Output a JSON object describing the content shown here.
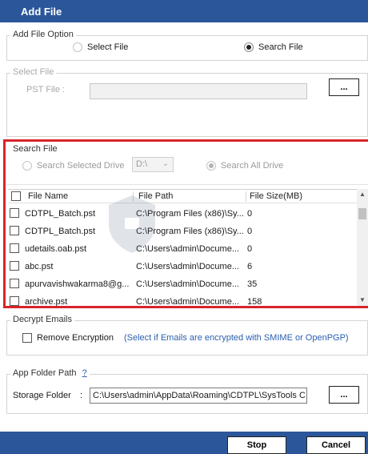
{
  "window": {
    "title": "Add File"
  },
  "add_file_option": {
    "label": "Add File Option",
    "select_file_label": "Select File",
    "search_file_label": "Search File",
    "selected": "search"
  },
  "select_file": {
    "label": "Select File",
    "pst_label": "PST File :",
    "browse_label": "..."
  },
  "search_file": {
    "label": "Search File",
    "search_selected_label": "Search Selected Drive",
    "drive_value": "D:\\",
    "search_all_label": "Search All Drive",
    "table": {
      "columns": [
        "File Name",
        "File Path",
        "File Size(MB)"
      ],
      "rows": [
        {
          "name": "CDTPL_Batch.pst",
          "path": "C:\\Program Files (x86)\\Sy...",
          "size": "0"
        },
        {
          "name": "CDTPL_Batch.pst",
          "path": "C:\\Program Files (x86)\\Sy...",
          "size": "0"
        },
        {
          "name": "udetails.oab.pst",
          "path": "C:\\Users\\admin\\Docume...",
          "size": "0"
        },
        {
          "name": "abc.pst",
          "path": "C:\\Users\\admin\\Docume...",
          "size": "6"
        },
        {
          "name": "apurvavishwakarma8@g...",
          "path": "C:\\Users\\admin\\Docume...",
          "size": "35"
        },
        {
          "name": "archive.pst",
          "path": "C:\\Users\\admin\\Docume...",
          "size": "158"
        }
      ]
    }
  },
  "decrypt": {
    "label": "Decrypt Emails",
    "remove_label": "Remove Encryption",
    "note": "(Select if Emails are encrypted with SMIME or OpenPGP)"
  },
  "app_folder": {
    "label": "App Folder Path",
    "help": "?",
    "storage_label": "Storage Folder",
    "colon": ":",
    "path_value": "C:\\Users\\admin\\AppData\\Roaming\\CDTPL\\SysTools C",
    "browse_label": "..."
  },
  "footer": {
    "stop_label": "Stop",
    "cancel_label": "Cancel"
  },
  "colors": {
    "title_bar": "#2b579a",
    "highlight_frame": "#d8242a",
    "note_text": "#2a5fb0"
  }
}
